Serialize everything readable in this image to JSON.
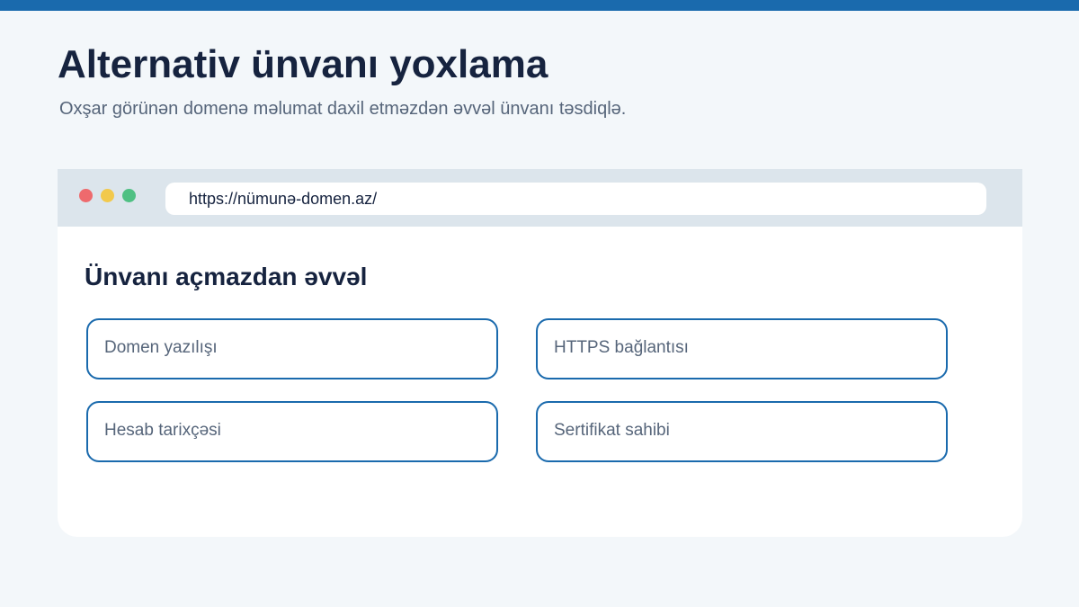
{
  "header": {
    "title": "Alternativ ünvanı yoxlama",
    "subtitle": "Oxşar görünən domenə məlumat daxil etməzdən əvvəl ünvanı təsdiqlə."
  },
  "browser": {
    "url": "https://nümunə-domen.az/",
    "window_dots": [
      "close-dot",
      "minimize-dot",
      "maximize-dot"
    ]
  },
  "content": {
    "heading": "Ünvanı açmazdan əvvəl",
    "checks": [
      {
        "label": "Domen yazılışı"
      },
      {
        "label": "HTTPS bağlantısı"
      },
      {
        "label": "Hesab tarixçəsi"
      },
      {
        "label": "Sertifikat sahibi"
      }
    ]
  },
  "colors": {
    "accent": "#1a6aad",
    "title": "#16233f",
    "muted_text": "#56657a",
    "background": "#f3f7fa",
    "chrome": "#dce5ec",
    "dot_red": "#ee6a6d",
    "dot_yellow": "#f2c94c",
    "dot_green": "#4fc083"
  }
}
